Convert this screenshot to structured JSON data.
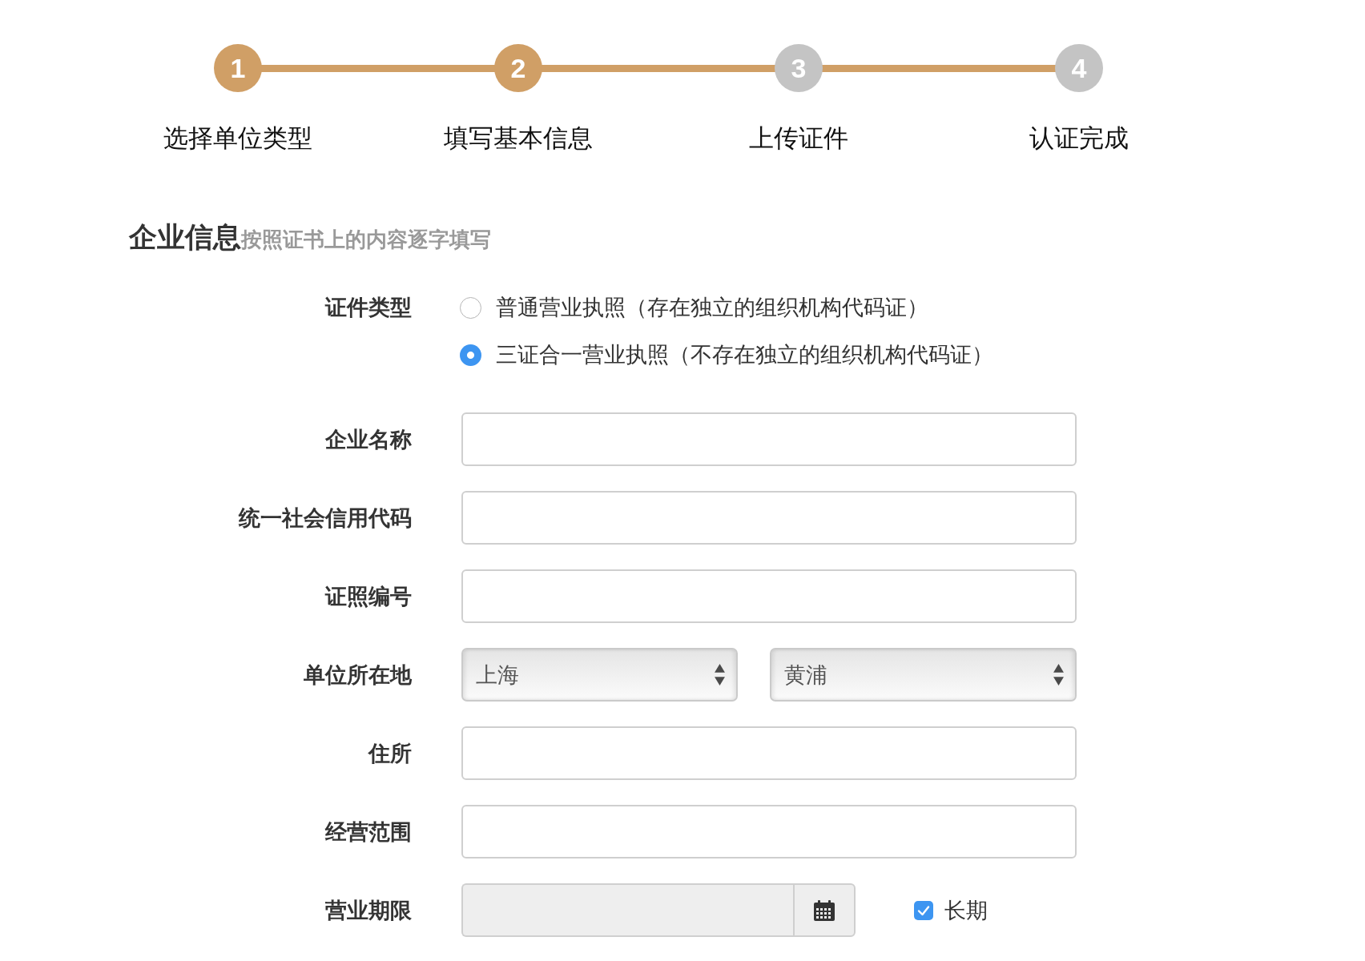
{
  "steps": [
    {
      "number": "1",
      "label": "选择单位类型",
      "active": true
    },
    {
      "number": "2",
      "label": "填写基本信息",
      "active": true
    },
    {
      "number": "3",
      "label": "上传证件",
      "active": false
    },
    {
      "number": "4",
      "label": "认证完成",
      "active": false
    }
  ],
  "section": {
    "title": "企业信息",
    "hint": "按照证书上的内容逐字填写"
  },
  "form": {
    "rows": [
      {
        "kind": "radio",
        "label": "证件类型",
        "options": [
          {
            "label": "普通营业执照（存在独立的组织机构代码证）",
            "selected": false
          },
          {
            "label": "三证合一营业执照（不存在独立的组织机构代码证）",
            "selected": true
          }
        ]
      },
      {
        "kind": "text",
        "label": "企业名称"
      },
      {
        "kind": "text",
        "label": "统一社会信用代码"
      },
      {
        "kind": "text",
        "label": "证照编号"
      },
      {
        "kind": "select",
        "label": "单位所在地",
        "selects": [
          {
            "value": "上海"
          },
          {
            "value": "黄浦"
          }
        ]
      },
      {
        "kind": "text",
        "label": "住所"
      },
      {
        "kind": "text",
        "label": "经营范围"
      },
      {
        "kind": "date",
        "label": "营业期限",
        "disabled": true,
        "checkbox": {
          "label": "长期",
          "checked": true
        }
      }
    ]
  }
}
